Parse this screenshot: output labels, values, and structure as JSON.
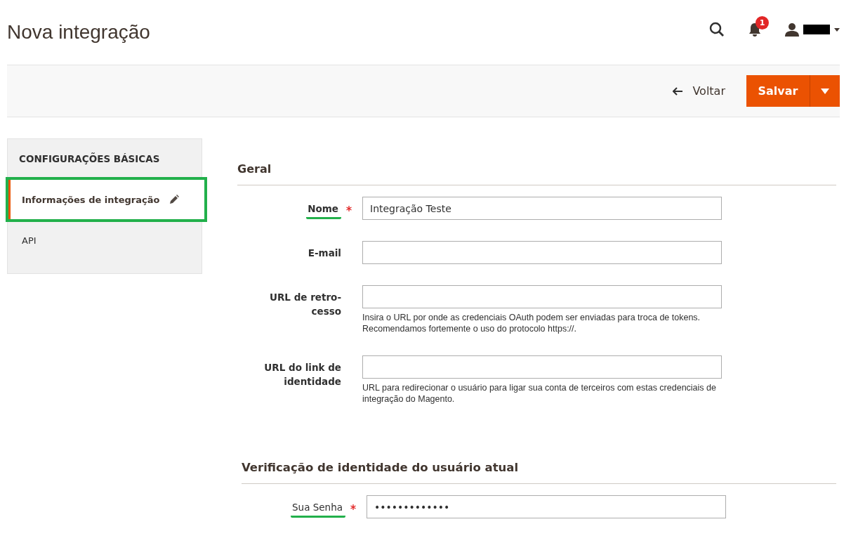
{
  "page_title": "Nova integração",
  "header": {
    "notification_count": "1"
  },
  "actions": {
    "back": "Voltar",
    "save": "Salvar"
  },
  "sidebar": {
    "title": "CONFIGURAÇÕES BÁSICAS",
    "items": [
      {
        "label": "Informações de integração",
        "selected": true,
        "highlighted": true,
        "edited": true
      },
      {
        "label": "API",
        "selected": false,
        "highlighted": false,
        "edited": false
      }
    ]
  },
  "sections": [
    {
      "title": "Geral",
      "fields": [
        {
          "label": "Nome",
          "required": true,
          "highlighted": true,
          "bold": true,
          "value": "Integração Teste"
        },
        {
          "label": "E-mail",
          "required": false,
          "highlighted": false,
          "bold": true
        },
        {
          "label": "URL de retro-cesso",
          "required": false,
          "highlighted": false,
          "bold": true,
          "note": "Insira o URL por onde as credenciais OAuth podem ser enviadas para troca de tokens. Recomendamos fortemente o uso do protocolo https://."
        },
        {
          "label": "URL do link de identidade",
          "required": false,
          "highlighted": false,
          "bold": true,
          "note": "URL para redirecionar o usuário para ligar sua conta de terceiros com estas credenciais de integração do Magento."
        }
      ]
    },
    {
      "title": "Verificação de identidade do usuário atual",
      "fields": [
        {
          "label": "Sua Senha",
          "required": true,
          "highlighted": true,
          "bold": false,
          "value": "•••••••••••••"
        }
      ]
    }
  ]
}
